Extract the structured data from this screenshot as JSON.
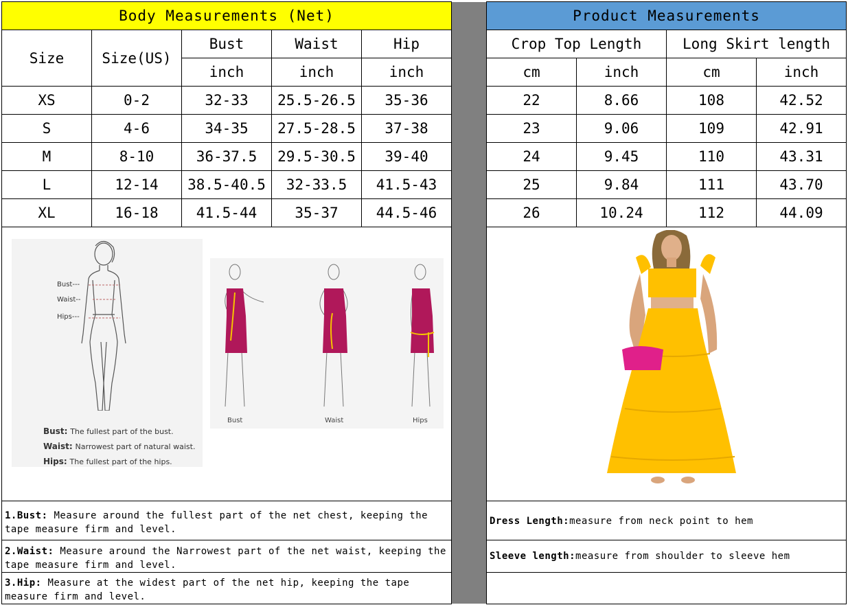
{
  "left_header": "Body Measurements (Net)",
  "right_header": "Product Measurements",
  "left_cols": {
    "size": "Size",
    "size_us": "Size(US)",
    "bust": "Bust",
    "waist": "Waist",
    "hip": "Hip",
    "unit": "inch"
  },
  "right_cols": {
    "crop": "Crop Top Length",
    "skirt": "Long Skirt length",
    "cm": "cm",
    "inch": "inch"
  },
  "rows": [
    {
      "size": "XS",
      "us": "0-2",
      "bust": "32-33",
      "waist": "25.5-26.5",
      "hip": "35-36",
      "crop_cm": "22",
      "crop_in": "8.66",
      "skirt_cm": "108",
      "skirt_in": "42.52"
    },
    {
      "size": "S",
      "us": "4-6",
      "bust": "34-35",
      "waist": "27.5-28.5",
      "hip": "37-38",
      "crop_cm": "23",
      "crop_in": "9.06",
      "skirt_cm": "109",
      "skirt_in": "42.91"
    },
    {
      "size": "M",
      "us": "8-10",
      "bust": "36-37.5",
      "waist": "29.5-30.5",
      "hip": "39-40",
      "crop_cm": "24",
      "crop_in": "9.45",
      "skirt_cm": "110",
      "skirt_in": "43.31"
    },
    {
      "size": "L",
      "us": "12-14",
      "bust": "38.5-40.5",
      "waist": "32-33.5",
      "hip": "41.5-43",
      "crop_cm": "25",
      "crop_in": "9.84",
      "skirt_cm": "111",
      "skirt_in": "43.70"
    },
    {
      "size": "XL",
      "us": "16-18",
      "bust": "41.5-44",
      "waist": "35-37",
      "hip": "44.5-46",
      "crop_cm": "26",
      "crop_in": "10.24",
      "skirt_cm": "112",
      "skirt_in": "44.09"
    }
  ],
  "figure_labels": {
    "bust": "Bust---",
    "waist": "Waist--",
    "hips": "Hips---"
  },
  "figure_notes": [
    {
      "term": "Bust:",
      "text": "The fullest part of the bust."
    },
    {
      "term": "Waist:",
      "text": "Narrowest part of natural waist."
    },
    {
      "term": "Hips:",
      "text": "The fullest part of the hips."
    }
  ],
  "dress_captions": [
    "Bust",
    "Waist",
    "Hips"
  ],
  "left_notes": [
    {
      "term": "1.Bust:",
      "text": " Measure around the fullest part of the net chest, keeping the tape  measure firm and level."
    },
    {
      "term": "2.Waist:",
      "text": " Measure around the Narrowest part of the net waist, keeping the tape  measure firm and level."
    },
    {
      "term": "3.Hip:",
      "text": " Measure at the widest part of the net hip, keeping the tape measure firm and level."
    }
  ],
  "right_notes": [
    {
      "term": "Dress Length:",
      "text": " measure from neck point to hem"
    },
    {
      "term": "Sleeve length:",
      "text": " measure from shoulder to sleeve hem"
    }
  ],
  "colors": {
    "left_header_bg": "#FFFF00",
    "right_header_bg": "#5B9BD5",
    "divider": "#808080",
    "dress_magenta": "#B0185A",
    "tape_yellow": "#F5C400",
    "outfit_yellow": "#FFC000",
    "clutch_pink": "#E0208A"
  }
}
